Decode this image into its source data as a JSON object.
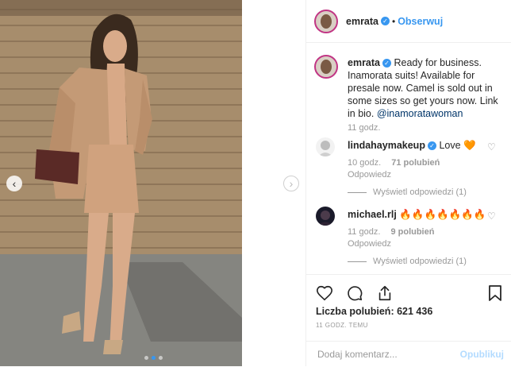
{
  "post": {
    "author": "emrata",
    "follow_label": "Obserwuj",
    "separator": "•",
    "verified_glyph": "✓"
  },
  "caption": {
    "author": "emrata",
    "text": "Ready for business. Inamorata suits! Available for presale now. Camel is sold out in some sizes so get yours now. Link in bio.",
    "mention": "@inamoratawoman",
    "time": "11 godz."
  },
  "comments": [
    {
      "user": "lindahaymakeup",
      "verified": true,
      "text": "Love",
      "emoji": "🧡",
      "time": "10 godz.",
      "likes": "71 polubień",
      "reply_label": "Odpowiedz",
      "view_replies": "Wyświetl odpowiedzi (1)"
    },
    {
      "user": "michael.rlj",
      "verified": false,
      "text": "",
      "emoji": "🔥🔥🔥🔥🔥🔥🔥",
      "time": "11 godz.",
      "likes": "9 polubień",
      "reply_label": "Odpowiedz",
      "view_replies": "Wyświetl odpowiedzi (1)"
    }
  ],
  "footer": {
    "likes_label": "Liczba polubień: 621 436",
    "timestamp": "11 GODZ. TEMU",
    "comment_placeholder": "Dodaj komentarz...",
    "publish_label": "Opublikuj"
  },
  "carousel": {
    "prev_glyph": "‹",
    "next_glyph": "›",
    "slide_count": 3,
    "active_slide": 1
  },
  "icons": {
    "like": "heart-icon",
    "comment": "comment-icon",
    "share": "share-icon",
    "save": "bookmark-icon",
    "comment_like": "heart-outline-icon"
  },
  "colors": {
    "accent": "#3897f0",
    "publish_disabled": "#b3dbff",
    "muted": "#999999",
    "border": "#efefef"
  }
}
